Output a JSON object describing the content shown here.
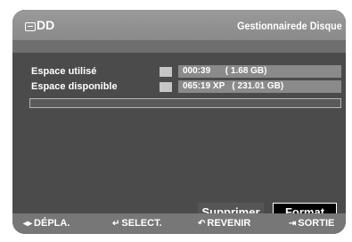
{
  "header": {
    "badge_icon": "hdd-icon",
    "title_left": "DD",
    "title_right": "Gestionnairede Disque"
  },
  "rows": [
    {
      "label": "Espace utilisé",
      "value": "000:39      ( 1.68 GB)"
    },
    {
      "label": "Espace disponible",
      "value": "065:19 XP   ( 231.01 GB)"
    }
  ],
  "buttons": {
    "delete": "Supprimer",
    "format": "Format"
  },
  "footer": [
    {
      "icon": "left-right-arrows-icon",
      "glyph": "◂▸",
      "label": "DÉPLA."
    },
    {
      "icon": "enter-select-icon",
      "glyph": "↵",
      "label": "SELECT."
    },
    {
      "icon": "return-icon",
      "glyph": "↶",
      "label": "REVENIR"
    },
    {
      "icon": "exit-icon",
      "glyph": "⇥",
      "label": "SORTIE"
    }
  ],
  "colors": {
    "titlebar": "#8f8f8f",
    "content": "#4b4b4b",
    "footer": "#777777"
  }
}
